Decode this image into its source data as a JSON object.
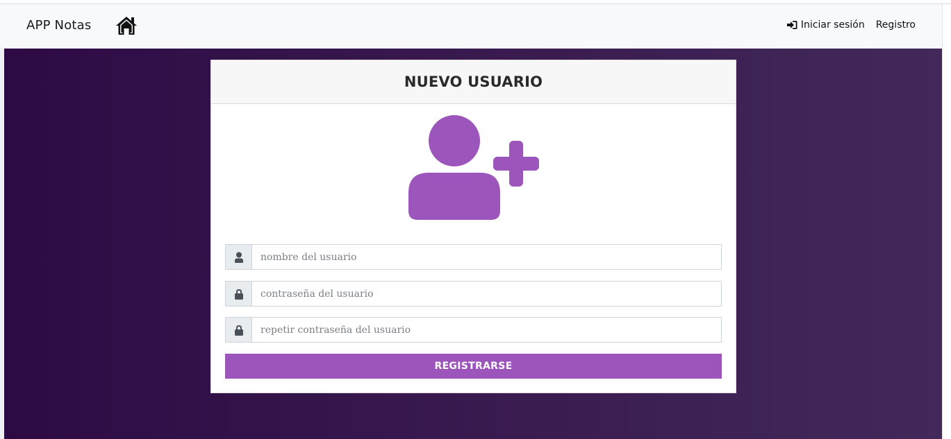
{
  "navbar": {
    "brand": "APP Notas",
    "home_icon": "home-icon",
    "login_label": "Iniciar sesión",
    "login_icon": "sign-in-icon",
    "register_label": "Registro"
  },
  "card": {
    "title": "NUEVO USUARIO",
    "avatar_icon": "user-plus-icon",
    "fields": [
      {
        "icon": "user-icon",
        "placeholder": "nombre del usuario",
        "value": ""
      },
      {
        "icon": "lock-icon",
        "placeholder": "contraseña del usuario",
        "value": ""
      },
      {
        "icon": "lock-icon",
        "placeholder": "repetir contraseña del usuario",
        "value": ""
      }
    ],
    "submit_label": "REGISTRARSE"
  },
  "colors": {
    "accent": "#9b55bb",
    "background_start": "#2d0a44",
    "background_end": "#42295a",
    "navbar": "#f8f9fa"
  }
}
